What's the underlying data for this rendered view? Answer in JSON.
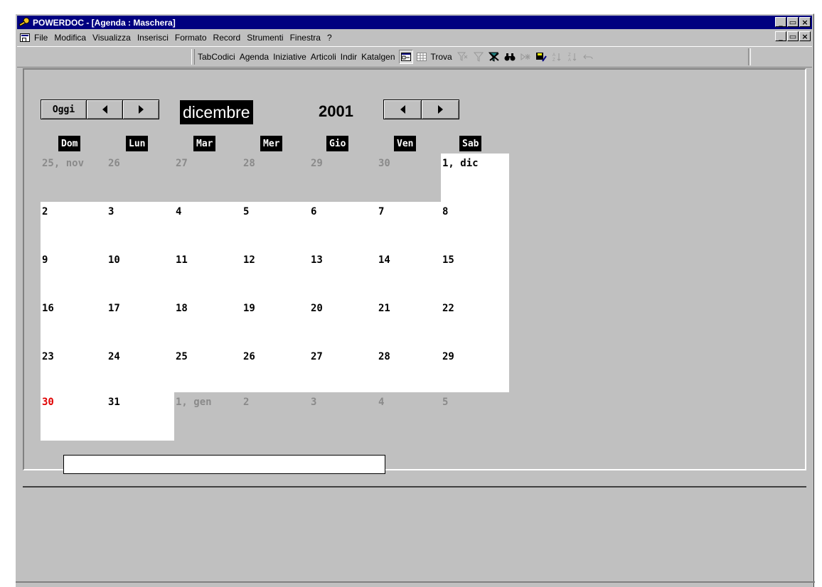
{
  "window": {
    "title": "POWERDOC - [Agenda : Maschera]",
    "buttons": {
      "minimize": "_",
      "restore": "▭",
      "close": "×"
    }
  },
  "menu": {
    "items": [
      {
        "label": "File"
      },
      {
        "label": "Modifica"
      },
      {
        "label": "Visualizza"
      },
      {
        "label": "Inserisci"
      },
      {
        "label": "Formato"
      },
      {
        "label": "Record"
      },
      {
        "label": "Strumenti"
      },
      {
        "label": "Finestra"
      },
      {
        "label": "?"
      }
    ]
  },
  "toolbar": {
    "items": [
      "TabCodici",
      "Agenda",
      "Iniziative",
      "Articoli",
      "Indir",
      "Katalgen"
    ],
    "find_label": "Trova"
  },
  "calendar": {
    "today_label": "Oggi",
    "month": "dicembre",
    "year": "2001",
    "weekdays": [
      "Dom",
      "Lun",
      "Mar",
      "Mer",
      "Gio",
      "Ven",
      "Sab"
    ],
    "weeks": [
      [
        "25, nov",
        "26",
        "27",
        "28",
        "29",
        "30",
        "1, dic"
      ],
      [
        "2",
        "3",
        "4",
        "5",
        "6",
        "7",
        "8"
      ],
      [
        "9",
        "10",
        "11",
        "12",
        "13",
        "14",
        "15"
      ],
      [
        "16",
        "17",
        "18",
        "19",
        "20",
        "21",
        "22"
      ],
      [
        "23",
        "24",
        "25",
        "26",
        "27",
        "28",
        "29"
      ],
      [
        "30",
        "31",
        "1, gen",
        "2",
        "3",
        "4",
        "5"
      ]
    ],
    "highlight_color": "#e00000"
  }
}
